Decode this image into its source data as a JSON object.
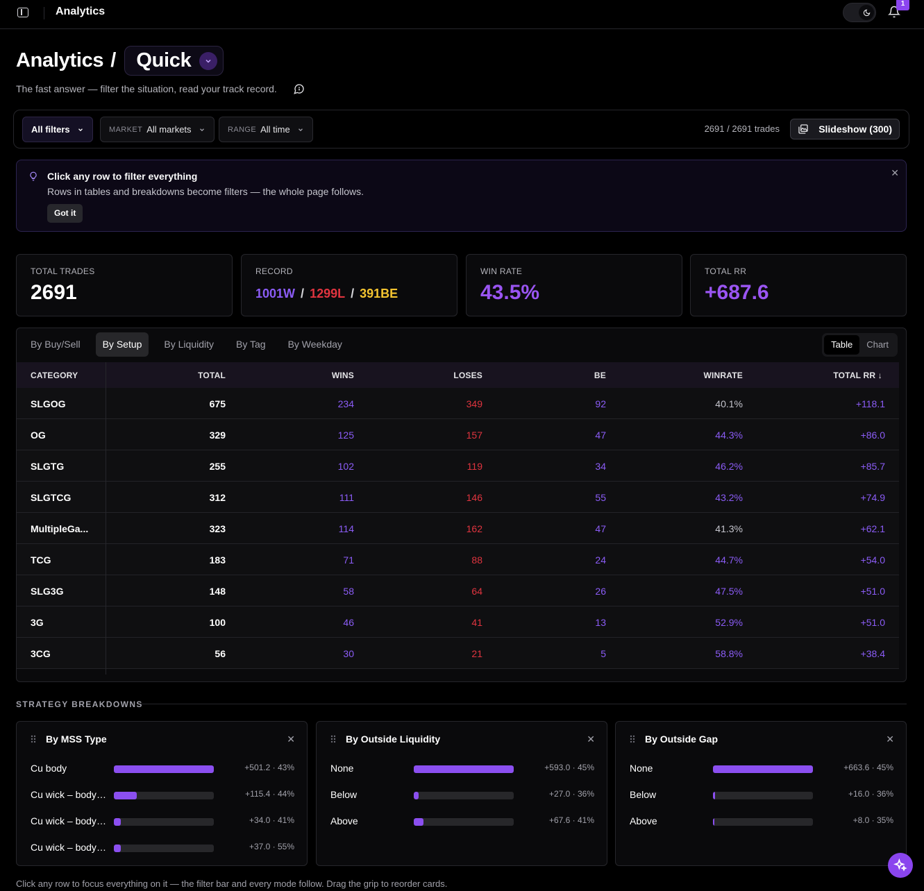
{
  "app": {
    "title": "Analytics",
    "notification_count": "1"
  },
  "page": {
    "title": "Analytics",
    "separator": "/",
    "mode": "Quick",
    "subtitle": "The fast answer — filter the situation, read your track record."
  },
  "filters": {
    "all_filters": "All filters",
    "market_tag": "MARKET",
    "market_value": "All markets",
    "range_tag": "RANGE",
    "range_value": "All time",
    "trade_count": "2691 / 2691 trades",
    "slideshow": "Slideshow (300)"
  },
  "tip": {
    "title": "Click any row to filter everything",
    "body": "Rows in tables and breakdowns become filters — the whole page follows.",
    "button": "Got it"
  },
  "kpis": {
    "total_trades_label": "TOTAL TRADES",
    "total_trades_value": "2691",
    "record_label": "RECORD",
    "record_wins": "1001W",
    "record_losses": "1299L",
    "record_be": "391BE",
    "record_sep": "/",
    "win_rate_label": "WIN RATE",
    "win_rate_value": "43.5%",
    "total_rr_label": "TOTAL RR",
    "total_rr_value": "+687.6"
  },
  "tabs": [
    "By Buy/Sell",
    "By Setup",
    "By Liquidity",
    "By Tag",
    "By Weekday"
  ],
  "active_tab": 1,
  "view_toggle": [
    "Table",
    "Chart"
  ],
  "table": {
    "headers": {
      "category": "CATEGORY",
      "total": "TOTAL",
      "wins": "WINS",
      "loses": "LOSES",
      "be": "BE",
      "winrate": "WINRATE",
      "total_rr": "TOTAL RR ↓"
    },
    "rows": [
      {
        "category": "SLGOG",
        "total": "675",
        "wins": "234",
        "loses": "349",
        "be": "92",
        "winrate": "40.1%",
        "rr": "+118.1",
        "wr_highlight": false
      },
      {
        "category": "OG",
        "total": "329",
        "wins": "125",
        "loses": "157",
        "be": "47",
        "winrate": "44.3%",
        "rr": "+86.0",
        "wr_highlight": true
      },
      {
        "category": "SLGTG",
        "total": "255",
        "wins": "102",
        "loses": "119",
        "be": "34",
        "winrate": "46.2%",
        "rr": "+85.7",
        "wr_highlight": true
      },
      {
        "category": "SLGTCG",
        "total": "312",
        "wins": "111",
        "loses": "146",
        "be": "55",
        "winrate": "43.2%",
        "rr": "+74.9",
        "wr_highlight": true
      },
      {
        "category": "MultipleGa...",
        "total": "323",
        "wins": "114",
        "loses": "162",
        "be": "47",
        "winrate": "41.3%",
        "rr": "+62.1",
        "wr_highlight": false
      },
      {
        "category": "TCG",
        "total": "183",
        "wins": "71",
        "loses": "88",
        "be": "24",
        "winrate": "44.7%",
        "rr": "+54.0",
        "wr_highlight": true
      },
      {
        "category": "SLG3G",
        "total": "148",
        "wins": "58",
        "loses": "64",
        "be": "26",
        "winrate": "47.5%",
        "rr": "+51.0",
        "wr_highlight": true
      },
      {
        "category": "3G",
        "total": "100",
        "wins": "46",
        "loses": "41",
        "be": "13",
        "winrate": "52.9%",
        "rr": "+51.0",
        "wr_highlight": true
      },
      {
        "category": "3CG",
        "total": "56",
        "wins": "30",
        "loses": "21",
        "be": "5",
        "winrate": "58.8%",
        "rr": "+38.4",
        "wr_highlight": true
      }
    ]
  },
  "breakdowns": {
    "section_label": "STRATEGY BREAKDOWNS",
    "cards": [
      {
        "title": "By MSS Type",
        "rows": [
          {
            "label": "Cu body",
            "value": "+501.2 · 43%",
            "fill": 1.0
          },
          {
            "label": "Cu wick – body ...",
            "value": "+115.4 · 44%",
            "fill": 0.23
          },
          {
            "label": "Cu wick – body ...",
            "value": "+34.0 · 41%",
            "fill": 0.07
          },
          {
            "label": "Cu wick – body l...",
            "value": "+37.0 · 55%",
            "fill": 0.07
          }
        ]
      },
      {
        "title": "By Outside Liquidity",
        "rows": [
          {
            "label": "None",
            "value": "+593.0 · 45%",
            "fill": 1.0
          },
          {
            "label": "Below",
            "value": "+27.0 · 36%",
            "fill": 0.05
          },
          {
            "label": "Above",
            "value": "+67.6 · 41%",
            "fill": 0.1
          }
        ]
      },
      {
        "title": "By Outside Gap",
        "rows": [
          {
            "label": "None",
            "value": "+663.6 · 45%",
            "fill": 1.0
          },
          {
            "label": "Below",
            "value": "+16.0 · 36%",
            "fill": 0.024
          },
          {
            "label": "Above",
            "value": "+8.0 · 35%",
            "fill": 0.012
          }
        ]
      }
    ]
  },
  "footnote": "Click any row to focus everything on it — the filter bar and every mode follow. Drag the grip to reorder cards.",
  "colors": {
    "accent": "#8b5cf6",
    "loss": "#e0343f",
    "breakeven": "#f4c430"
  }
}
